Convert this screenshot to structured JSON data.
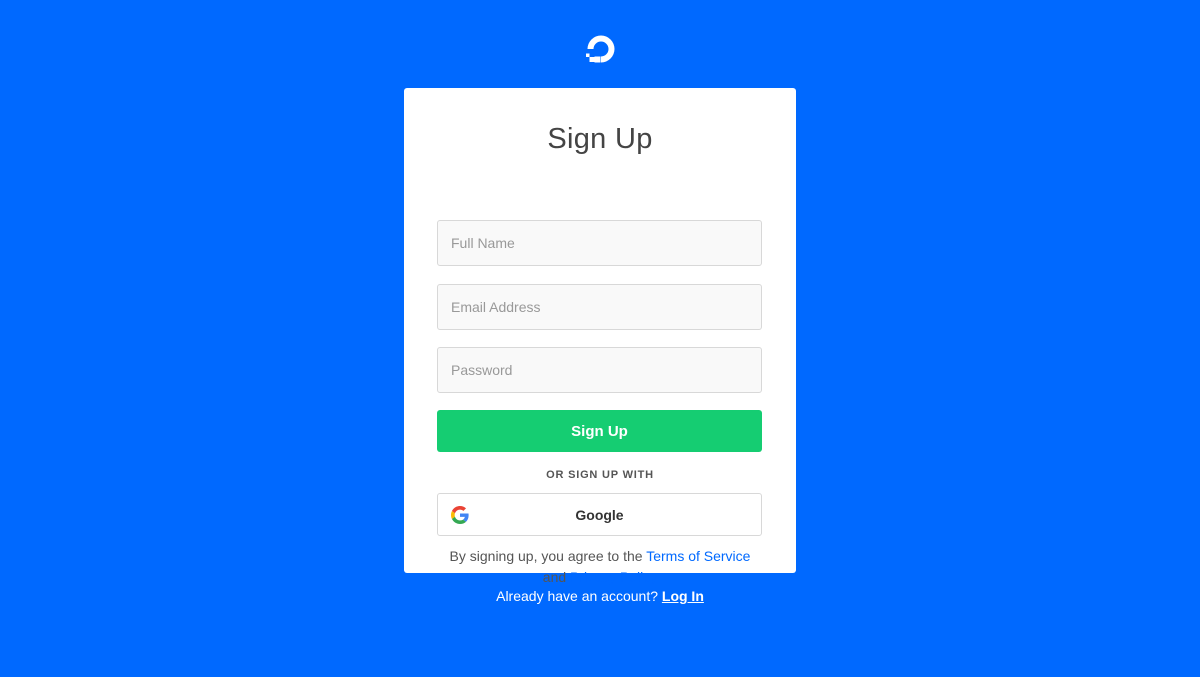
{
  "brand": {
    "logo_icon": "digitalocean-logo-icon",
    "background_color": "#0069ff"
  },
  "form": {
    "title": "Sign Up",
    "fields": {
      "full_name": {
        "placeholder": "Full Name",
        "value": ""
      },
      "email": {
        "placeholder": "Email Address",
        "value": ""
      },
      "password": {
        "placeholder": "Password",
        "value": ""
      }
    },
    "submit_label": "Sign Up",
    "submit_color": "#15cd72",
    "divider_label": "OR SIGN UP WITH",
    "google_label": "Google",
    "google_icon": "google-g-icon",
    "terms": {
      "prefix": "By signing up, you agree to the",
      "terms_link": "Terms of Service",
      "middle": "and",
      "privacy_link": "Privacy Policy"
    }
  },
  "footer": {
    "prompt": "Already have an account?",
    "login_link": "Log In"
  }
}
